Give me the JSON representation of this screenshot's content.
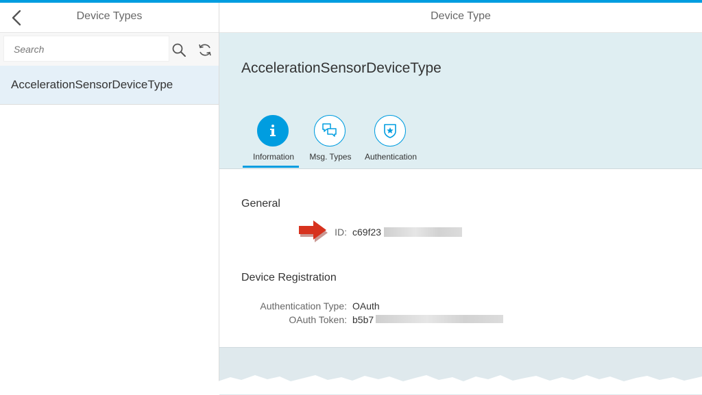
{
  "master": {
    "title": "Device Types",
    "search_placeholder": "Search",
    "items": [
      {
        "label": "AccelerationSensorDeviceType"
      }
    ]
  },
  "detail": {
    "title": "Device Type",
    "object_title": "AccelerationSensorDeviceType",
    "tabs": [
      {
        "label": "Information",
        "icon": "info-icon",
        "active": true
      },
      {
        "label": "Msg. Types",
        "icon": "message-bubbles-icon",
        "active": false
      },
      {
        "label": "Authentication",
        "icon": "badge-icon",
        "active": false
      }
    ],
    "general": {
      "title": "General",
      "id_label": "ID:",
      "id_value": "c69f23"
    },
    "registration": {
      "title": "Device Registration",
      "auth_type_label": "Authentication Type:",
      "auth_type_value": "OAuth",
      "token_label": "OAuth Token:",
      "token_value": "b5b7"
    }
  },
  "colors": {
    "accent": "#009de0",
    "header_bg": "#dfeef2",
    "selected_item_bg": "#e5f0f8",
    "arrow": "#d7321e"
  }
}
